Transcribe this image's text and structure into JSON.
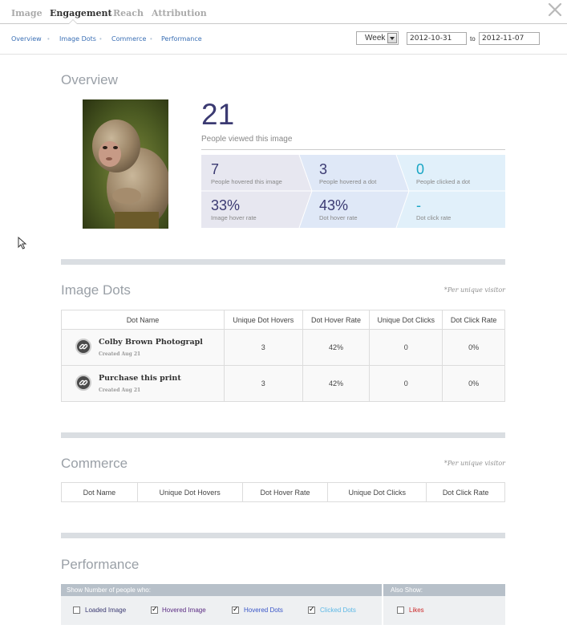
{
  "topnav": {
    "tabs": [
      {
        "label": "Image",
        "active": false
      },
      {
        "label": "Engagement",
        "active": true
      },
      {
        "label": "Reach",
        "active": false
      },
      {
        "label": "Attribution",
        "active": false
      }
    ],
    "close_icon": "close-x-icon"
  },
  "subnav": {
    "links": [
      "Overview",
      "Image Dots",
      "Commerce",
      "Performance"
    ],
    "separator": "•",
    "period": "Week",
    "date_from": "2012-10-31",
    "to_label": "to",
    "date_to": "2012-11-07"
  },
  "overview": {
    "title": "Overview",
    "views": "21",
    "views_label": "People viewed this image",
    "stats": [
      {
        "value": "7",
        "label": "People hovered this image"
      },
      {
        "value": "3",
        "label": "People hovered a dot"
      },
      {
        "value": "0",
        "label": "People clicked a dot"
      },
      {
        "value": "33%",
        "label": "Image hover rate"
      },
      {
        "value": "43%",
        "label": "Dot hover rate"
      },
      {
        "value": "-",
        "label": "Dot click rate"
      }
    ]
  },
  "image_dots": {
    "title": "Image Dots",
    "note": "*Per unique visitor",
    "columns": [
      "Dot Name",
      "Unique Dot Hovers",
      "Dot Hover Rate",
      "Unique Dot Clicks",
      "Dot Click Rate"
    ],
    "rows": [
      {
        "name": "Colby Brown Photograpl",
        "created": "Created Aug 21",
        "hovers": "3",
        "hover_rate": "42%",
        "clicks": "0",
        "click_rate": "0%"
      },
      {
        "name": "Purchase this print",
        "created": "Created Aug 21",
        "hovers": "3",
        "hover_rate": "42%",
        "clicks": "0",
        "click_rate": "0%"
      }
    ]
  },
  "commerce": {
    "title": "Commerce",
    "note": "*Per unique visitor",
    "columns": [
      "Dot Name",
      "Unique Dot Hovers",
      "Dot Hover Rate",
      "Unique Dot Clicks",
      "Dot Click Rate"
    ]
  },
  "performance": {
    "title": "Performance",
    "show_label": "Show Number of people who:",
    "also_label": "Also Show:",
    "options": [
      {
        "label": "Loaded Image",
        "checked": false,
        "color": "#3b3a72"
      },
      {
        "label": "Hovered Image",
        "checked": true,
        "color": "#5a2a82"
      },
      {
        "label": "Hovered Dots",
        "checked": true,
        "color": "#3a56c8"
      },
      {
        "label": "Clicked Dots",
        "checked": true,
        "color": "#5cb8e6"
      },
      {
        "label": "Likes",
        "checked": false,
        "color": "#cc2a2a"
      }
    ]
  },
  "colors": {
    "accent": "#3b3a72",
    "link": "#3a6fb5",
    "teal": "#19a6c4"
  }
}
